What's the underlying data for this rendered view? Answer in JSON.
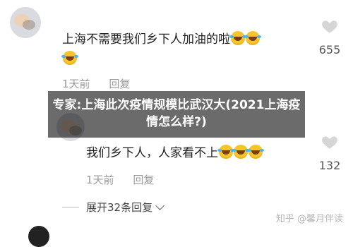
{
  "comments": [
    {
      "text": "上海不需要我们乡下人加油的啦",
      "emoji_icons": [
        "rolling-laughing-emoji",
        "rolling-laughing-emoji",
        "rolling-laughing-emoji"
      ],
      "time": "1天前",
      "reply_label": "回复",
      "likes": "655"
    },
    {
      "text": "我们乡下人，人家看不上",
      "emoji_icons": [
        "rolling-laughing-emoji",
        "rolling-laughing-emoji",
        "rolling-laughing-emoji"
      ],
      "time": "1天前",
      "reply_label": "回复",
      "likes": "132"
    }
  ],
  "expand_replies": "展开32条回复",
  "overlay_title": "专家:上海此次疫情规模比武汉大(2021上海疫情怎么样?)",
  "watermark": "知乎 @馨月伴读",
  "icons": {
    "like": "heart-outline-icon",
    "expand": "chevron-down-icon"
  },
  "colors": {
    "overlay_bg": "#000000",
    "meta_text": "#9a9a9a",
    "emoji": "#f7c52a"
  }
}
